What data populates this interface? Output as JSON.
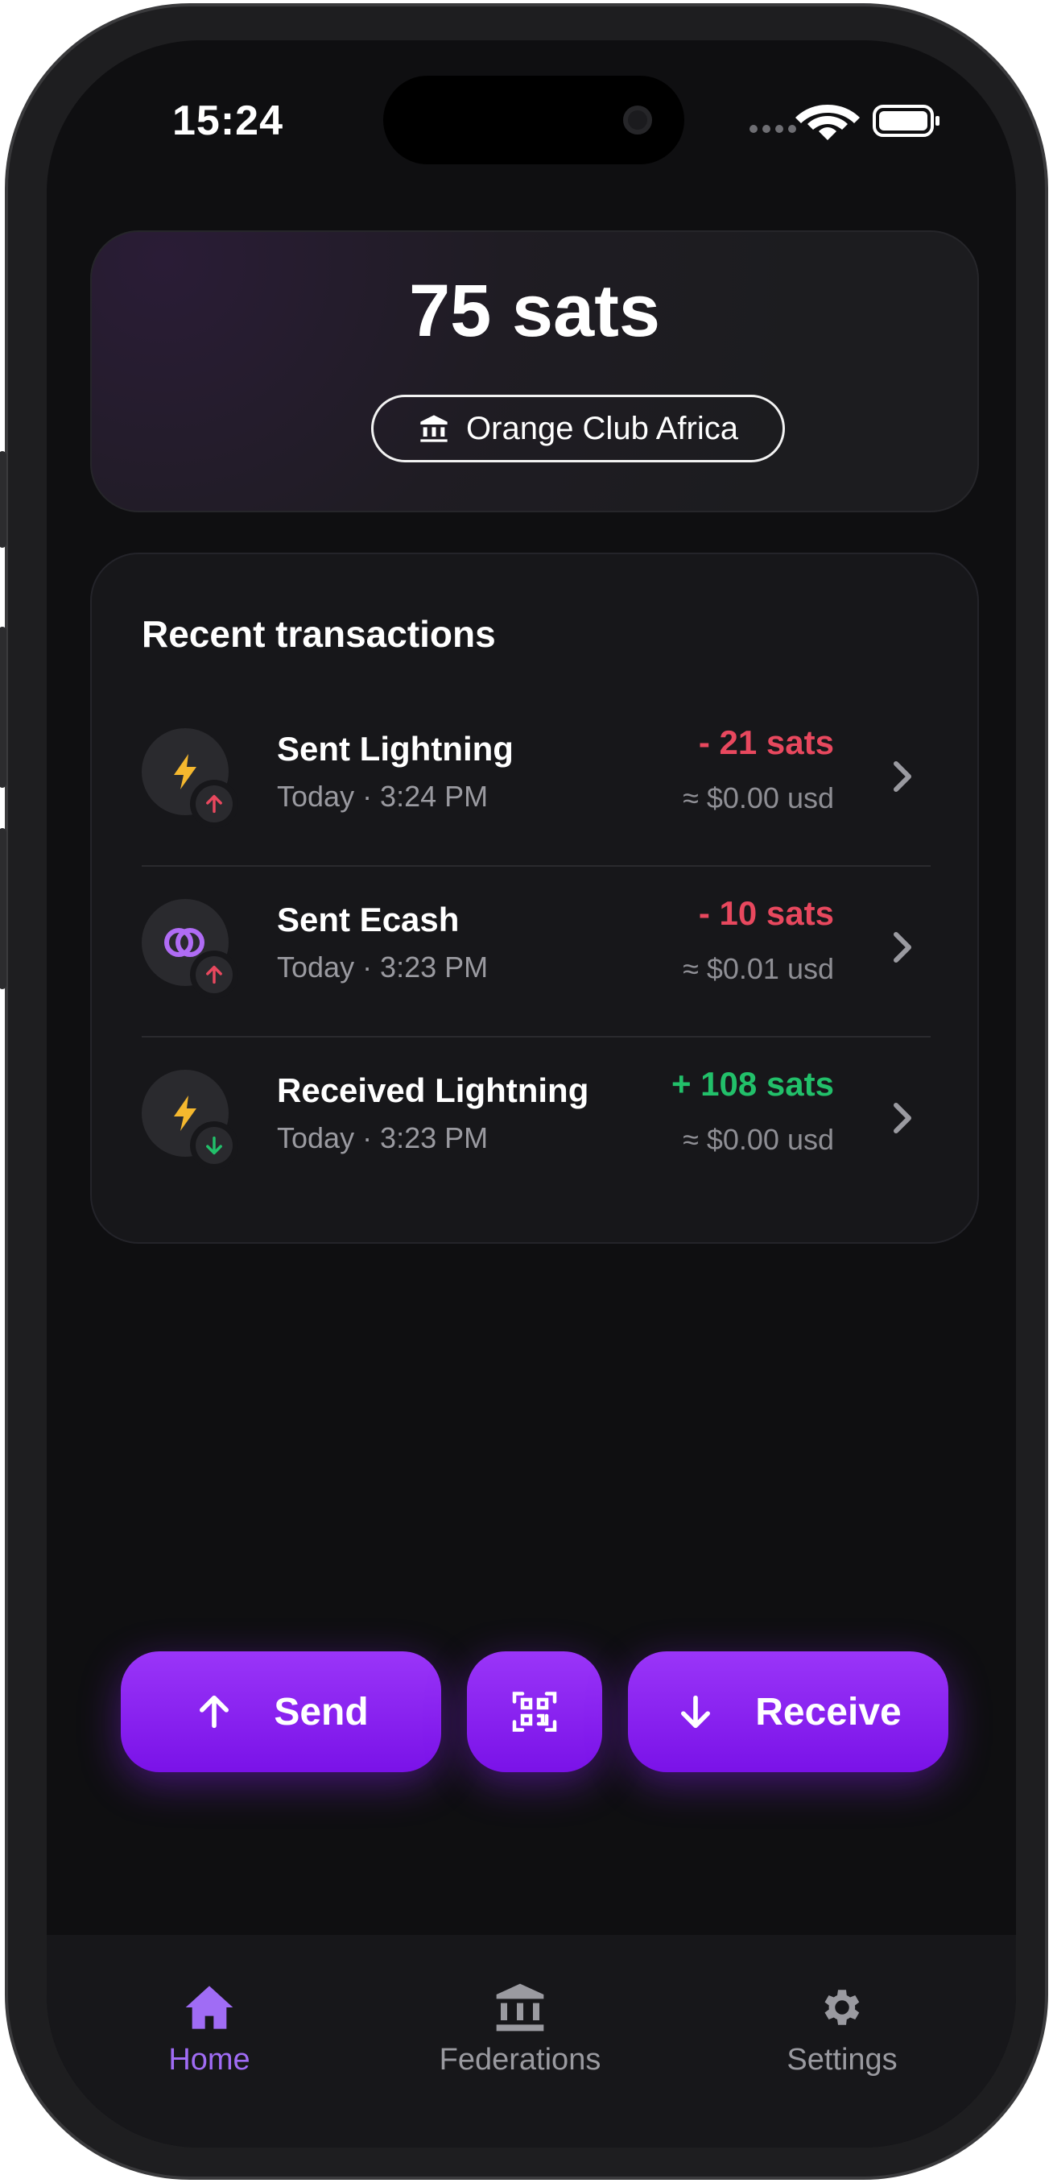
{
  "status_bar": {
    "time": "15:24"
  },
  "balance": {
    "amount": "75 sats",
    "federation_name": "Orange Club Africa"
  },
  "transactions": {
    "heading": "Recent transactions",
    "items": [
      {
        "title": "Sent Lightning",
        "time": "Today · 3:24 PM",
        "amount": "- 21 sats",
        "usd": "≈ $0.00 usd",
        "type_icon": "lightning-icon",
        "direction": "sent"
      },
      {
        "title": "Sent Ecash",
        "time": "Today · 3:23 PM",
        "amount": "- 10 sats",
        "usd": "≈ $0.01 usd",
        "type_icon": "ecash-icon",
        "direction": "sent"
      },
      {
        "title": "Received Lightning",
        "time": "Today · 3:23 PM",
        "amount": "+ 108 sats",
        "usd": "≈ $0.00 usd",
        "type_icon": "lightning-icon",
        "direction": "received"
      }
    ]
  },
  "actions": {
    "send_label": "Send",
    "receive_label": "Receive",
    "scan_icon": "qr-scan-icon"
  },
  "nav": {
    "home_label": "Home",
    "federations_label": "Federations",
    "settings_label": "Settings"
  },
  "colors": {
    "accent": "#8b2cf5",
    "negative": "#e8485e",
    "positive": "#22c06a",
    "lightning": "#f5b82e",
    "nav_active": "#a06cf5",
    "nav_inactive": "#9a9aa0"
  }
}
